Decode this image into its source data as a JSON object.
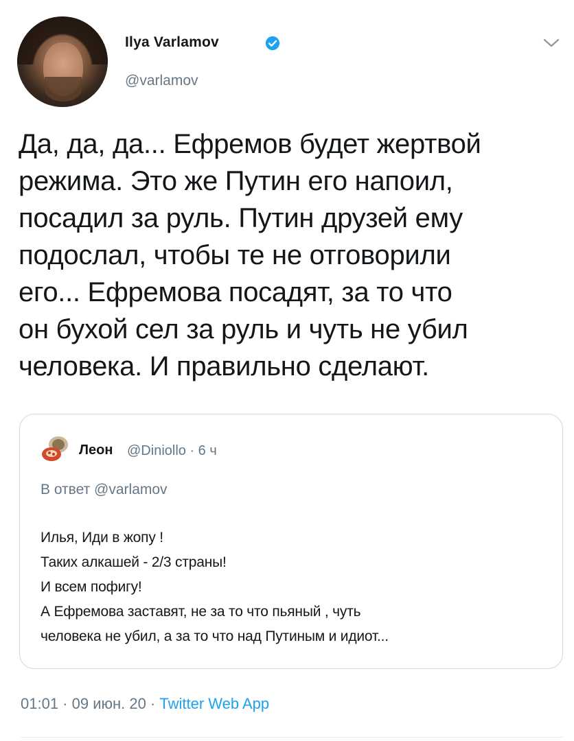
{
  "author": {
    "name": "Ilya Varlamov",
    "handle": "@varlamov",
    "verified_color": "#1da1f2"
  },
  "tweet": {
    "text": "Да, да, да... Ефремов будет жертвой\nрежима. Это же Путин его напоил,\nпосадил за руль. Путин друзей ему\nподослал, чтобы те не отговорили\nего... Ефремова посадят, за то что\nон бухой сел за руль и чуть не убил\nчеловека. И правильно сделают."
  },
  "quote": {
    "name": "Леон",
    "handle_time": "@Diniollo · 6 ч",
    "reply_to": "В ответ @varlamov",
    "text": "Илья, Иди в жопу !\nТаких  алкашей - 2/3 страны!\nИ всем пофигу!\nА Ефремова заставят, не за то что пьяный , чуть\nчеловека не убил,  а за то что над Путиным и идиот..."
  },
  "meta": {
    "datetime": "01:01 · 09 июн. 20 · ",
    "app": "Twitter Web App"
  },
  "icons": {
    "verified": "verified-badge-icon",
    "chevron": "chevron-down-icon"
  },
  "colors": {
    "accent": "#1da1f2",
    "secondary_text": "#657786",
    "border": "#ccd6dd"
  }
}
